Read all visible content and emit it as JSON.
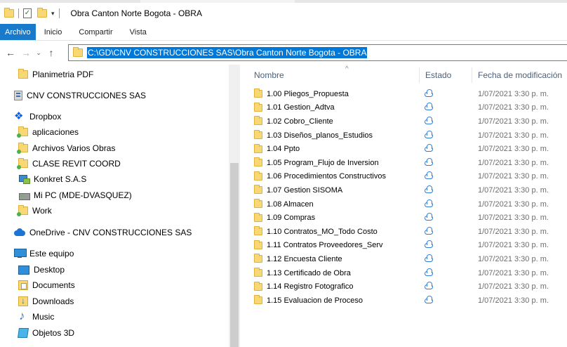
{
  "window": {
    "title": "Obra Canton Norte Bogota - OBRA"
  },
  "ribbon": {
    "tabs": [
      "Archivo",
      "Inicio",
      "Compartir",
      "Vista"
    ]
  },
  "address": {
    "path": "C:\\GD\\CNV CONSTRUCCIONES SAS\\Obra Canton Norte Bogota - OBRA"
  },
  "nav_pane": {
    "items": [
      {
        "label": "Planimetria PDF",
        "icon": "folder-icon"
      },
      {
        "label": "CNV CONSTRUCCIONES SAS",
        "icon": "company-icon"
      },
      {
        "label": "Dropbox",
        "icon": "dropbox-icon"
      },
      {
        "label": "aplicaciones",
        "icon": "folder-icon"
      },
      {
        "label": "Archivos Varios Obras",
        "icon": "folder-icon"
      },
      {
        "label": "CLASE REVIT COORD",
        "icon": "folder-icon"
      },
      {
        "label": "Konkret S.A.S",
        "icon": "network-icon"
      },
      {
        "label": "Mi PC (MDE-DVASQUEZ)",
        "icon": "drive-icon"
      },
      {
        "label": "Work",
        "icon": "folder-icon"
      },
      {
        "label": "OneDrive - CNV CONSTRUCCIONES SAS",
        "icon": "onedrive-icon"
      },
      {
        "label": "Este equipo",
        "icon": "pc-icon"
      },
      {
        "label": "Desktop",
        "icon": "desktop-icon"
      },
      {
        "label": "Documents",
        "icon": "documents-icon"
      },
      {
        "label": "Downloads",
        "icon": "downloads-icon"
      },
      {
        "label": "Music",
        "icon": "music-icon"
      },
      {
        "label": "Objetos 3D",
        "icon": "objects-3d-icon"
      }
    ]
  },
  "file_list": {
    "columns": {
      "name": "Nombre",
      "status": "Estado",
      "date": "Fecha de modificación"
    },
    "rows": [
      {
        "name": "1.00 Pliegos_Propuesta",
        "date": "1/07/2021 3:30 p. m."
      },
      {
        "name": "1.01 Gestion_Adtva",
        "date": "1/07/2021 3:30 p. m."
      },
      {
        "name": "1.02 Cobro_Cliente",
        "date": "1/07/2021 3:30 p. m."
      },
      {
        "name": "1.03 Diseños_planos_Estudios",
        "date": "1/07/2021 3:30 p. m."
      },
      {
        "name": "1.04 Ppto",
        "date": "1/07/2021 3:30 p. m."
      },
      {
        "name": "1.05 Program_Flujo de Inversion",
        "date": "1/07/2021 3:30 p. m."
      },
      {
        "name": "1.06 Procedimientos Constructivos",
        "date": "1/07/2021 3:30 p. m."
      },
      {
        "name": "1.07 Gestion SISOMA",
        "date": "1/07/2021 3:30 p. m."
      },
      {
        "name": "1.08 Almacen",
        "date": "1/07/2021 3:30 p. m."
      },
      {
        "name": "1.09 Compras",
        "date": "1/07/2021 3:30 p. m."
      },
      {
        "name": "1.10 Contratos_MO_Todo Costo",
        "date": "1/07/2021 3:30 p. m."
      },
      {
        "name": "1.11 Contratos Proveedores_Serv",
        "date": "1/07/2021 3:30 p. m."
      },
      {
        "name": "1.12 Encuesta Cliente",
        "date": "1/07/2021 3:30 p. m."
      },
      {
        "name": "1.13 Certificado de Obra",
        "date": "1/07/2021 3:30 p. m."
      },
      {
        "name": "1.14 Registro Fotografico",
        "date": "1/07/2021 3:30 p. m."
      },
      {
        "name": "1.15 Evaluacion de Proceso",
        "date": "1/07/2021 3:30 p. m."
      }
    ]
  },
  "colors": {
    "accent": "#1979ca",
    "selection": "#0078d7",
    "folder": "#f8d775",
    "cloud_status": "#2e7cd6"
  }
}
